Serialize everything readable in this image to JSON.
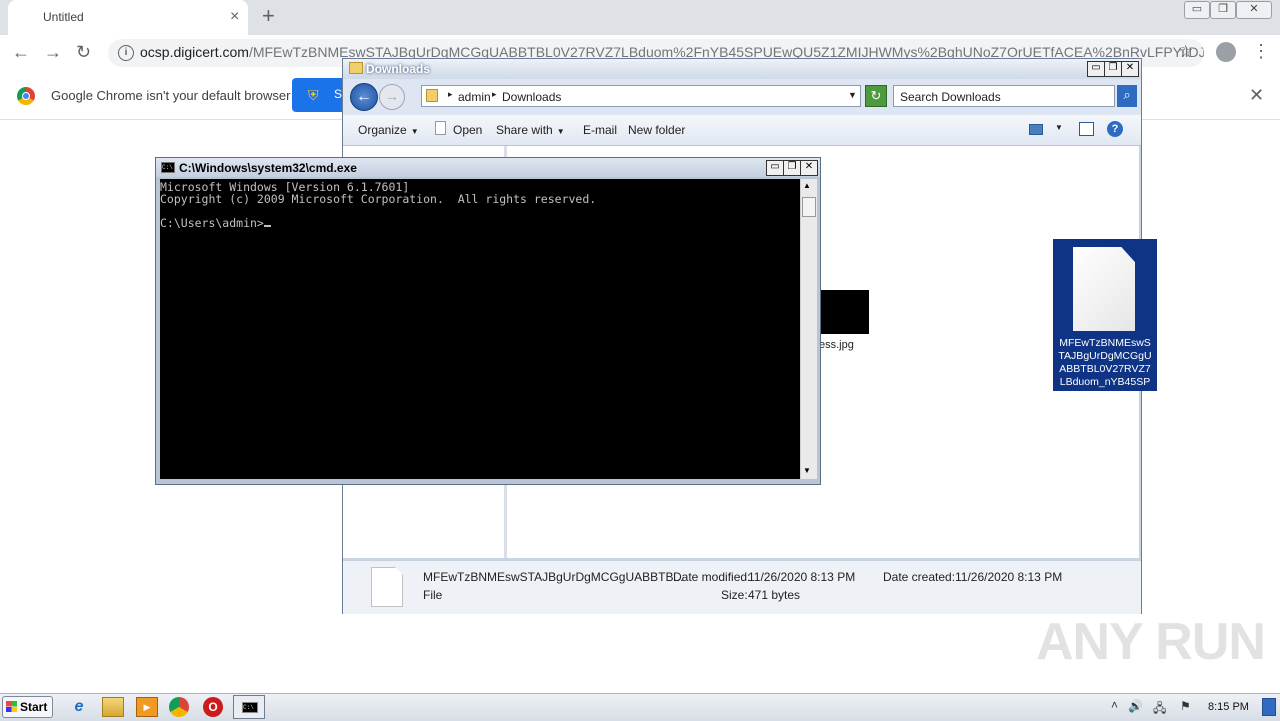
{
  "browser": {
    "tab_title": "Untitled",
    "tab_close_icon": "×",
    "new_tab_icon": "+",
    "window_controls": {
      "minimize": "▭",
      "restore": "❐",
      "close": "✕"
    },
    "url_host": "ocsp.digicert.com",
    "url_path": "/MFEwTzBNMEswSTAJBgUrDgMCGgUABBTBL0V27RVZ7LBduom%2FnYB45SPUEwQU5Z1ZMIJHWMys%2BghUNoZ7OrUETfACEA%2BnRvLFPYiIDJi...",
    "infobar_text": "Google Chrome isn't your default browser",
    "infobar_button": "S",
    "infobar_close": "✕"
  },
  "explorer": {
    "title": "Downloads",
    "breadcrumb": [
      "admin",
      "Downloads"
    ],
    "search_placeholder": "Search Downloads",
    "commands": {
      "organize": "Organize",
      "open": "Open",
      "share_with": "Share with",
      "email": "E-mail",
      "new_folder": "New folder"
    },
    "help_icon": "?",
    "files": [
      {
        "label": "ess.jpg",
        "type": "image"
      },
      {
        "label": "MFEwTzBNMEswSTAJBgUrDgMCGgUABBTBL0V27RVZ7LBduom_nYB45SPUE...",
        "type": "file",
        "selected": true
      }
    ],
    "details": {
      "name": "MFEwTzBNMEswSTAJBgUrDgMCGgUABBTB...",
      "type": "File",
      "date_modified_label": "Date modified:",
      "date_modified": "11/26/2020 8:13 PM",
      "size_label": "Size:",
      "size": "471 bytes",
      "date_created_label": "Date created:",
      "date_created": "11/26/2020 8:13 PM"
    }
  },
  "cmd": {
    "title": "C:\\Windows\\system32\\cmd.exe",
    "icon_text": "C:\\",
    "lines": [
      "Microsoft Windows [Version 6.1.7601]",
      "Copyright (c) 2009 Microsoft Corporation.  All rights reserved.",
      "",
      "C:\\Users\\admin>"
    ]
  },
  "watermark": "ANY RUN",
  "taskbar": {
    "start_label": "Start",
    "cmd_icon_text": "C:\\",
    "opera_icon_text": "O",
    "ie_icon_text": "e",
    "media_icon_text": "▶",
    "tray_up_icon": "˄",
    "clock": "8:15 PM"
  },
  "icons": {
    "star": "☆",
    "menu": "⋮",
    "back": "←",
    "forward": "→",
    "reload": "↻",
    "info": "i",
    "shield": "⛨",
    "volume": "🔊",
    "flag": "⚑",
    "network": "🖧"
  }
}
